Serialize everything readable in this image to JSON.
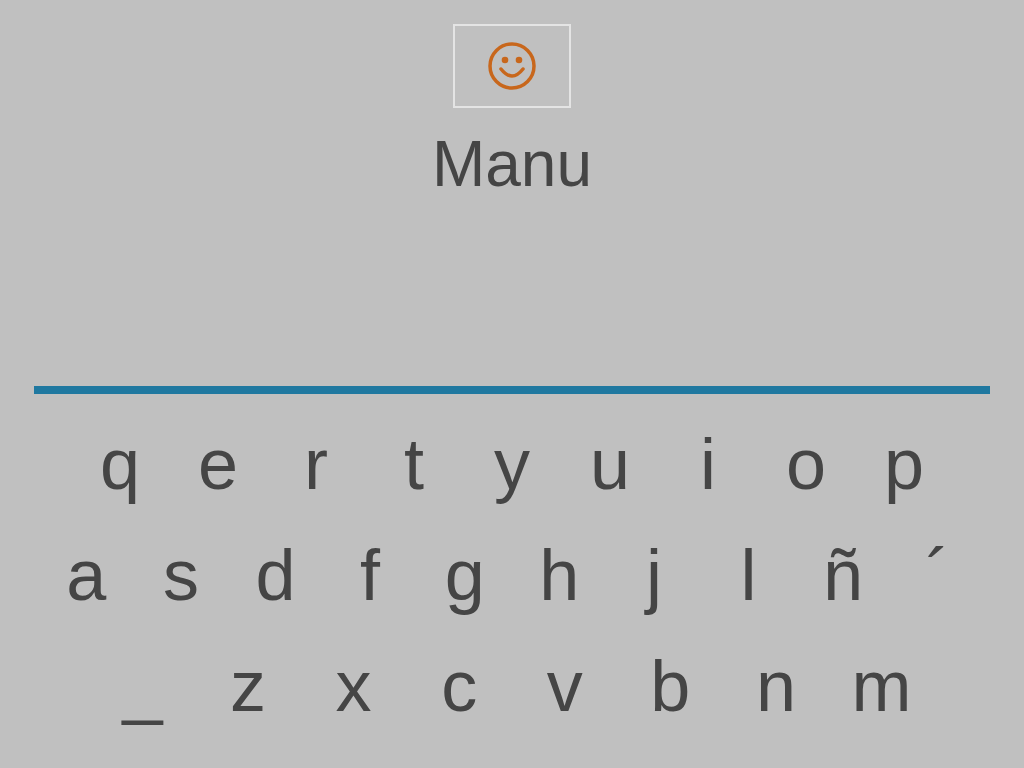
{
  "name": "Manu",
  "keyboard": {
    "rows": [
      [
        "q",
        "e",
        "r",
        "t",
        "y",
        "u",
        "i",
        "o",
        "p"
      ],
      [
        "a",
        "s",
        "d",
        "f",
        "g",
        "h",
        "j",
        "l",
        "ñ",
        "´"
      ],
      [
        "_",
        "z",
        "x",
        "c",
        "v",
        "b",
        "n",
        "m"
      ]
    ]
  }
}
